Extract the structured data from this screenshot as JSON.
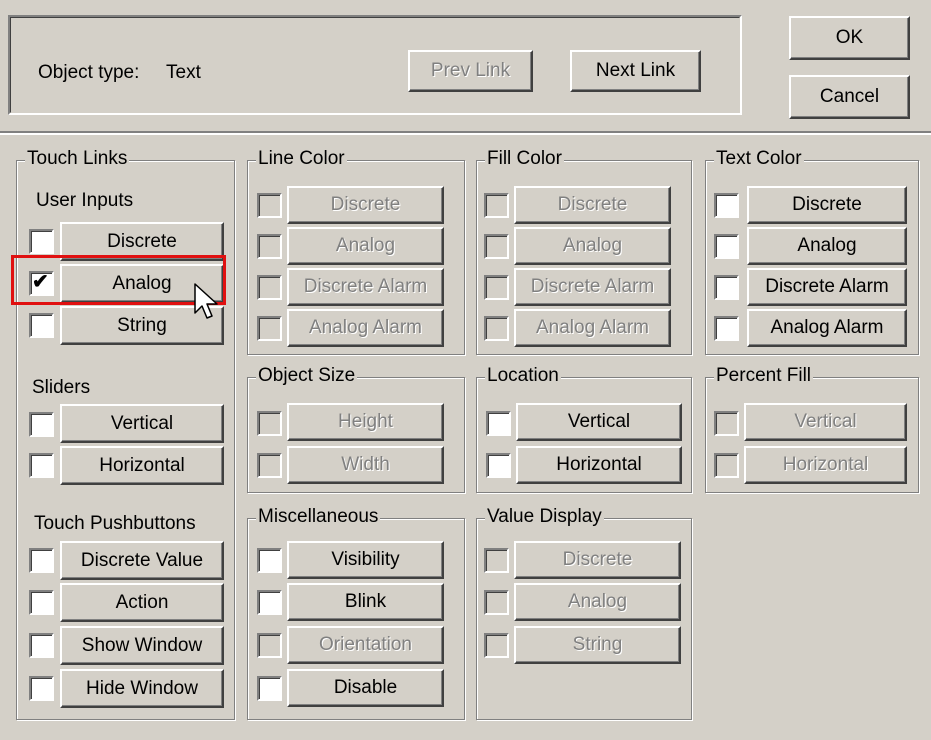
{
  "header": {
    "object_type_label": "Object type:",
    "object_type_value": "Text",
    "prev_link": "Prev Link",
    "next_link": "Next Link",
    "ok": "OK",
    "cancel": "Cancel"
  },
  "touch_links": {
    "title": "Touch Links",
    "user_inputs_label": "User Inputs",
    "discrete": "Discrete",
    "analog": "Analog",
    "string": "String",
    "sliders_label": "Sliders",
    "vertical": "Vertical",
    "horizontal": "Horizontal",
    "pushbuttons_label": "Touch Pushbuttons",
    "discrete_value": "Discrete Value",
    "action": "Action",
    "show_window": "Show Window",
    "hide_window": "Hide Window",
    "analog_checked": true
  },
  "line_color": {
    "title": "Line Color",
    "discrete": "Discrete",
    "analog": "Analog",
    "discrete_alarm": "Discrete Alarm",
    "analog_alarm": "Analog Alarm"
  },
  "fill_color": {
    "title": "Fill Color",
    "discrete": "Discrete",
    "analog": "Analog",
    "discrete_alarm": "Discrete Alarm",
    "analog_alarm": "Analog Alarm"
  },
  "text_color": {
    "title": "Text Color",
    "discrete": "Discrete",
    "analog": "Analog",
    "discrete_alarm": "Discrete Alarm",
    "analog_alarm": "Analog Alarm"
  },
  "object_size": {
    "title": "Object Size",
    "height": "Height",
    "width": "Width"
  },
  "location": {
    "title": "Location",
    "vertical": "Vertical",
    "horizontal": "Horizontal"
  },
  "percent_fill": {
    "title": "Percent Fill",
    "vertical": "Vertical",
    "horizontal": "Horizontal"
  },
  "miscellaneous": {
    "title": "Miscellaneous",
    "visibility": "Visibility",
    "blink": "Blink",
    "orientation": "Orientation",
    "disable": "Disable"
  },
  "value_display": {
    "title": "Value Display",
    "discrete": "Discrete",
    "analog": "Analog",
    "string": "String"
  },
  "check_mark": "✔",
  "colors": {
    "face": "#d4d0c8",
    "highlight_box": "#e01010"
  }
}
